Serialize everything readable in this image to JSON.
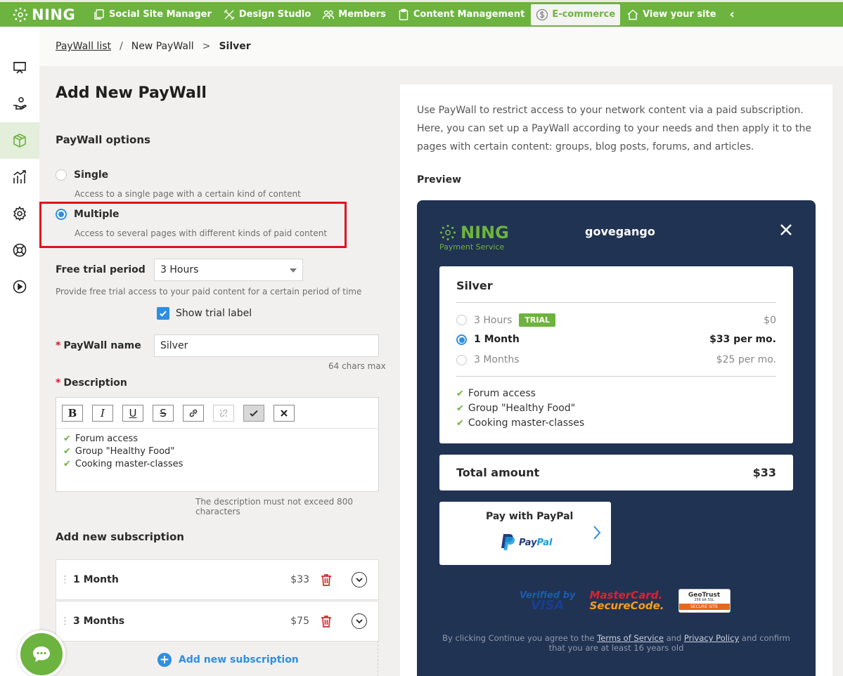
{
  "topnav": {
    "logo": "NING",
    "items": [
      {
        "label": "Social Site Manager",
        "icon": "copy-icon"
      },
      {
        "label": "Design Studio",
        "icon": "tools-icon"
      },
      {
        "label": "Members",
        "icon": "users-icon"
      },
      {
        "label": "Content Management",
        "icon": "clipboard-icon"
      },
      {
        "label": "E-commerce",
        "icon": "dollar-icon"
      },
      {
        "label": "View your site",
        "icon": "home-icon"
      }
    ],
    "back": "‹",
    "brand_color": "#6db33f"
  },
  "breadcrumb": {
    "link": "PayWall list",
    "separator1": "/",
    "middle": "New PayWall",
    "separator2": ">",
    "current": "Silver"
  },
  "form": {
    "title": "Add New PayWall",
    "options_title": "PayWall options",
    "single_label": "Single",
    "single_desc": "Access to a single page with a certain kind of content",
    "multiple_label": "Multiple",
    "multiple_desc": "Access to several pages with different kinds of paid content",
    "trial_label": "Free trial period",
    "trial_value": "3 Hours",
    "trial_hint": "Provide free trial access to your paid content for a certain period of time",
    "show_trial_label": "Show trial label",
    "name_label": "PayWall name",
    "name_value": "Silver",
    "name_hint": "64 chars max",
    "desc_label": "Description",
    "desc_lines": [
      "Forum access",
      "Group \"Healthy Food\"",
      "Cooking master-classes"
    ],
    "desc_hint": "The description must not exceed 800 characters",
    "toolbar": {
      "bold": "B",
      "italic": "I",
      "underline": "U",
      "strike": "S"
    },
    "subs_title": "Add new subscription",
    "subscriptions": [
      {
        "name": "1 Month",
        "price": "$33"
      },
      {
        "name": "3 Months",
        "price": "$75"
      }
    ],
    "add_sub_label": "Add new subscription"
  },
  "info": {
    "intro": "Use PayWall to restrict access to your network content via a paid subscription. Here, you can set up a PayWall according to your needs and then apply it to the pages with certain content: groups, blog posts, forums, and articles.",
    "preview_label": "Preview"
  },
  "preview": {
    "logo": "NING",
    "logo_sub": "Payment Service",
    "site": "govegango",
    "plan": "Silver",
    "options": [
      {
        "name": "3 Hours",
        "badge": "TRIAL",
        "price": "$0",
        "selected": false
      },
      {
        "name": "1 Month",
        "price": "$33 per mo.",
        "selected": true
      },
      {
        "name": "3 Months",
        "price": "$25 per mo.",
        "selected": false
      }
    ],
    "features": [
      "Forum access",
      "Group \"Healthy Food\"",
      "Cooking master-classes"
    ],
    "total_label": "Total amount",
    "total_value": "$33",
    "pay_label": "Pay with PayPal",
    "paypal_a": "Pay",
    "paypal_b": "Pal",
    "visa_a": "Verified by",
    "visa_b": "VISA",
    "mc_a": "MasterCard.",
    "mc_b": "SecureCode.",
    "geo_a": "GeoTrust",
    "geo_b": "256 bit SSL",
    "geo_c": "SECURE SITE",
    "terms_pre": "By clicking Continue you agree to the",
    "terms_tos": "Terms of Service",
    "terms_and": "and",
    "terms_pp": "Privacy Policy",
    "terms_post": "and confirm that you are at least 16 years old",
    "bg_color": "#213353"
  }
}
